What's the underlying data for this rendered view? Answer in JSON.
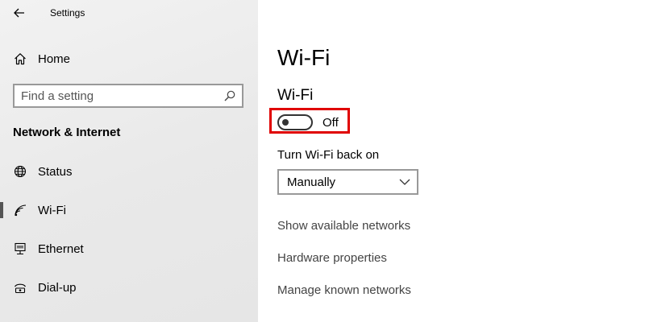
{
  "window": {
    "app_title": "Settings"
  },
  "sidebar": {
    "back_icon": "back-arrow-icon",
    "home": {
      "label": "Home",
      "icon": "home-icon"
    },
    "search": {
      "placeholder": "Find a setting",
      "value": "",
      "icon": "search-icon"
    },
    "section_heading": "Network & Internet",
    "items": [
      {
        "label": "Status",
        "icon": "globe-icon",
        "selected": false
      },
      {
        "label": "Wi-Fi",
        "icon": "wifi-icon",
        "selected": true
      },
      {
        "label": "Ethernet",
        "icon": "ethernet-icon",
        "selected": false
      },
      {
        "label": "Dial-up",
        "icon": "dial-up-icon",
        "selected": false
      }
    ]
  },
  "main": {
    "page_title": "Wi-Fi",
    "wifi_heading": "Wi-Fi",
    "toggle": {
      "state": "off",
      "label": "Off"
    },
    "highlight_color": "#e00000",
    "turn_back_on_label": "Turn Wi-Fi back on",
    "turn_back_on_value": "Manually",
    "links": [
      "Show available networks",
      "Hardware properties",
      "Manage known networks"
    ]
  }
}
